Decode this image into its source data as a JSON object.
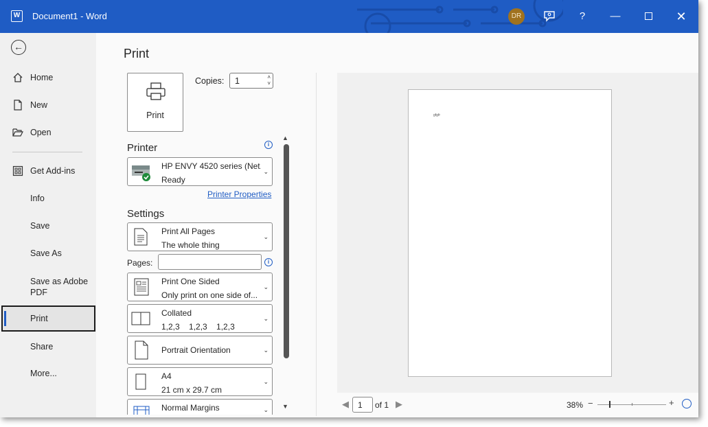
{
  "titlebar": {
    "app_icon": "W",
    "title": "Document1  -  Word",
    "avatar_initials": "DR",
    "accent": "#1f5cc4"
  },
  "sidebar": {
    "items": [
      {
        "label": "Home",
        "icon": "home-icon"
      },
      {
        "label": "New",
        "icon": "new-document-icon"
      },
      {
        "label": "Open",
        "icon": "folder-open-icon"
      },
      {
        "label": "Get Add-ins",
        "icon": "add-ins-grid-icon"
      },
      {
        "label": "Info"
      },
      {
        "label": "Save"
      },
      {
        "label": "Save As"
      },
      {
        "label": "Save as Adobe PDF"
      },
      {
        "label": "Print",
        "active": true
      },
      {
        "label": "Share"
      },
      {
        "label": "More..."
      }
    ]
  },
  "main": {
    "title": "Print",
    "print_button": "Print",
    "copies_label": "Copies:",
    "copies_value": "1",
    "printer_heading": "Printer",
    "printer": {
      "name": "HP ENVY 4520 series (Net...",
      "status": "Ready"
    },
    "printer_properties": "Printer Properties",
    "settings_heading": "Settings",
    "pages_label": "Pages:",
    "settings": {
      "print_range": {
        "line1": "Print All Pages",
        "line2": "The whole thing"
      },
      "sides": {
        "line1": "Print One Sided",
        "line2": "Only print on one side of..."
      },
      "collation": {
        "line1": "Collated",
        "line2": "1,2,3    1,2,3    1,2,3"
      },
      "orientation": {
        "line1": "Portrait Orientation"
      },
      "paper": {
        "line1": "A4",
        "line2": "21 cm x 29.7 cm"
      },
      "margins": {
        "line1": "Normal Margins"
      }
    }
  },
  "preview": {
    "page_text": "gfgfr",
    "current_page": "1",
    "of_pages": "of 1",
    "zoom": "38%"
  }
}
